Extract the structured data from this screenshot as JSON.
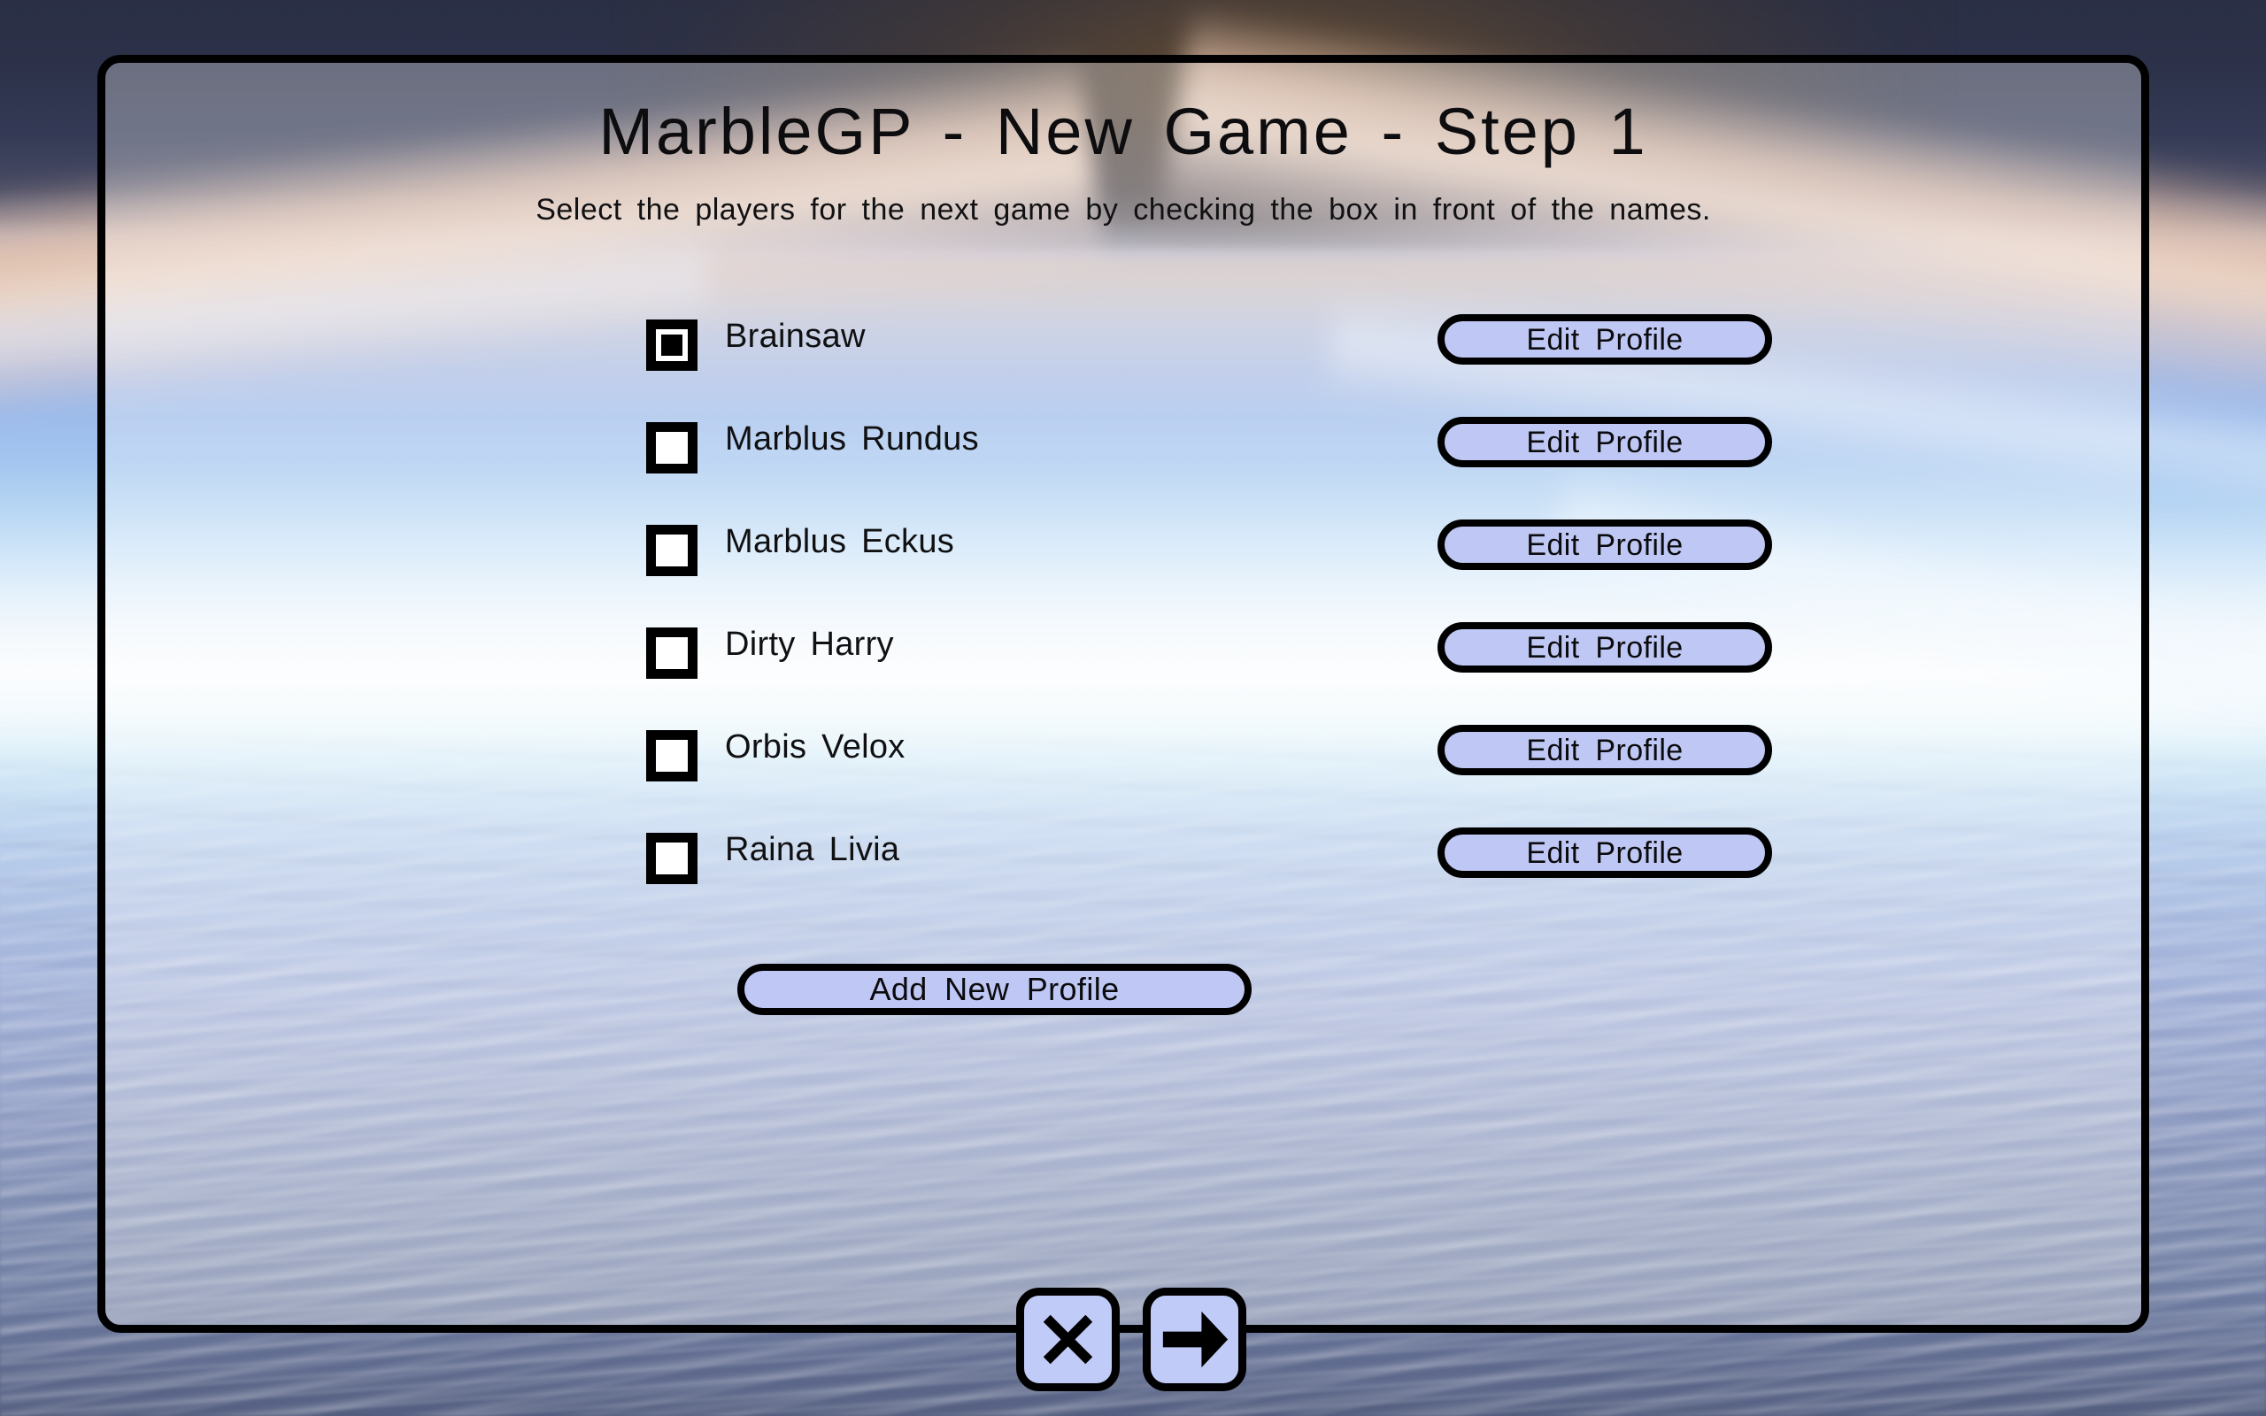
{
  "dialog": {
    "title": "MarbleGP - New Game - Step 1",
    "subtitle": "Select the players for the next game by checking the box in front of the names."
  },
  "players": [
    {
      "name": "Brainsaw",
      "checked": true,
      "edit_label": "Edit Profile"
    },
    {
      "name": "Marblus Rundus",
      "checked": false,
      "edit_label": "Edit Profile"
    },
    {
      "name": "Marblus Eckus",
      "checked": false,
      "edit_label": "Edit Profile"
    },
    {
      "name": "Dirty Harry",
      "checked": false,
      "edit_label": "Edit Profile"
    },
    {
      "name": "Orbis Velox",
      "checked": false,
      "edit_label": "Edit Profile"
    },
    {
      "name": "Raina Livia",
      "checked": false,
      "edit_label": "Edit Profile"
    }
  ],
  "actions": {
    "add_profile_label": "Add New Profile",
    "cancel_icon": "close-x-icon",
    "next_icon": "arrow-right-icon"
  },
  "colors": {
    "button_fill": "#bfc8f5",
    "outline": "#000000",
    "text": "#101012",
    "panel_overlay": "rgba(255,255,255,0.30)"
  }
}
